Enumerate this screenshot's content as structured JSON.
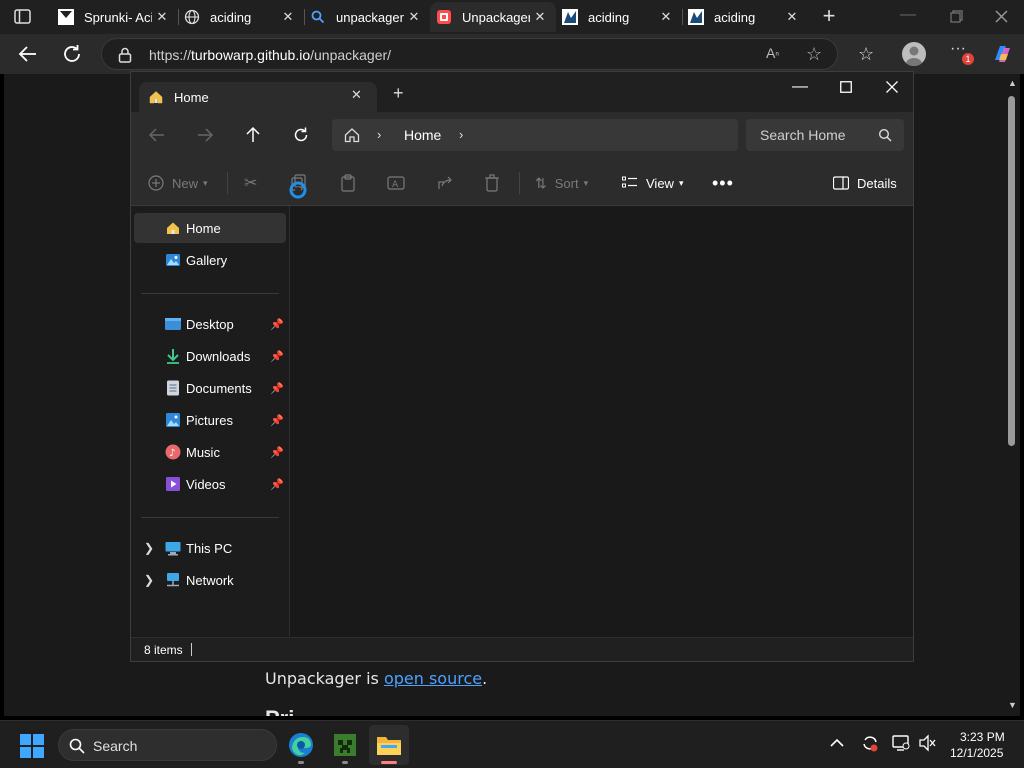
{
  "browser": {
    "tabs": [
      {
        "title": "Sprunki- Aci",
        "icon": "sprunki-favicon",
        "active": false
      },
      {
        "title": "aciding",
        "icon": "globe-icon",
        "active": false
      },
      {
        "title": "unpackager",
        "icon": "search-icon",
        "active": false
      },
      {
        "title": "Unpackager",
        "icon": "turbowarp-favicon",
        "active": true
      },
      {
        "title": "aciding",
        "icon": "scratch-favicon",
        "active": false
      },
      {
        "title": "aciding",
        "icon": "scratch-favicon",
        "active": false
      }
    ],
    "url_prefix": "https://",
    "url_domain": "turbowarp.github.io",
    "url_path": "/unpackager/",
    "notification_badge": "1"
  },
  "page": {
    "text_before_link": "Unpackager is ",
    "link_text": "open source",
    "text_after_link": ".",
    "heading_partial": "Pri"
  },
  "explorer": {
    "tab_title": "Home",
    "breadcrumb_current": "Home",
    "search_placeholder": "Search Home",
    "commands": {
      "new_label": "New",
      "sort_label": "Sort",
      "view_label": "View",
      "details_label": "Details"
    },
    "sidebar": {
      "top": [
        {
          "label": "Home",
          "icon": "home-icon",
          "selected": true
        },
        {
          "label": "Gallery",
          "icon": "gallery-icon",
          "selected": false
        }
      ],
      "pinned": [
        {
          "label": "Desktop",
          "icon": "desktop-folder-icon"
        },
        {
          "label": "Downloads",
          "icon": "downloads-folder-icon"
        },
        {
          "label": "Documents",
          "icon": "documents-folder-icon"
        },
        {
          "label": "Pictures",
          "icon": "pictures-folder-icon"
        },
        {
          "label": "Music",
          "icon": "music-folder-icon"
        },
        {
          "label": "Videos",
          "icon": "videos-folder-icon"
        }
      ],
      "bottom": [
        {
          "label": "This PC",
          "icon": "computer-icon"
        },
        {
          "label": "Network",
          "icon": "network-icon"
        }
      ]
    },
    "status_text": "8 items"
  },
  "taskbar": {
    "search_label": "Search",
    "apps": [
      "edge-icon",
      "minecraft-icon",
      "file-explorer-icon"
    ],
    "time": "3:23 PM",
    "date": "12/1/2025"
  },
  "colors": {
    "accent": "#4ea1ff",
    "window_bg": "#191919",
    "chrome_bg": "#202020",
    "toolbar_bg": "#2c2c2c"
  }
}
